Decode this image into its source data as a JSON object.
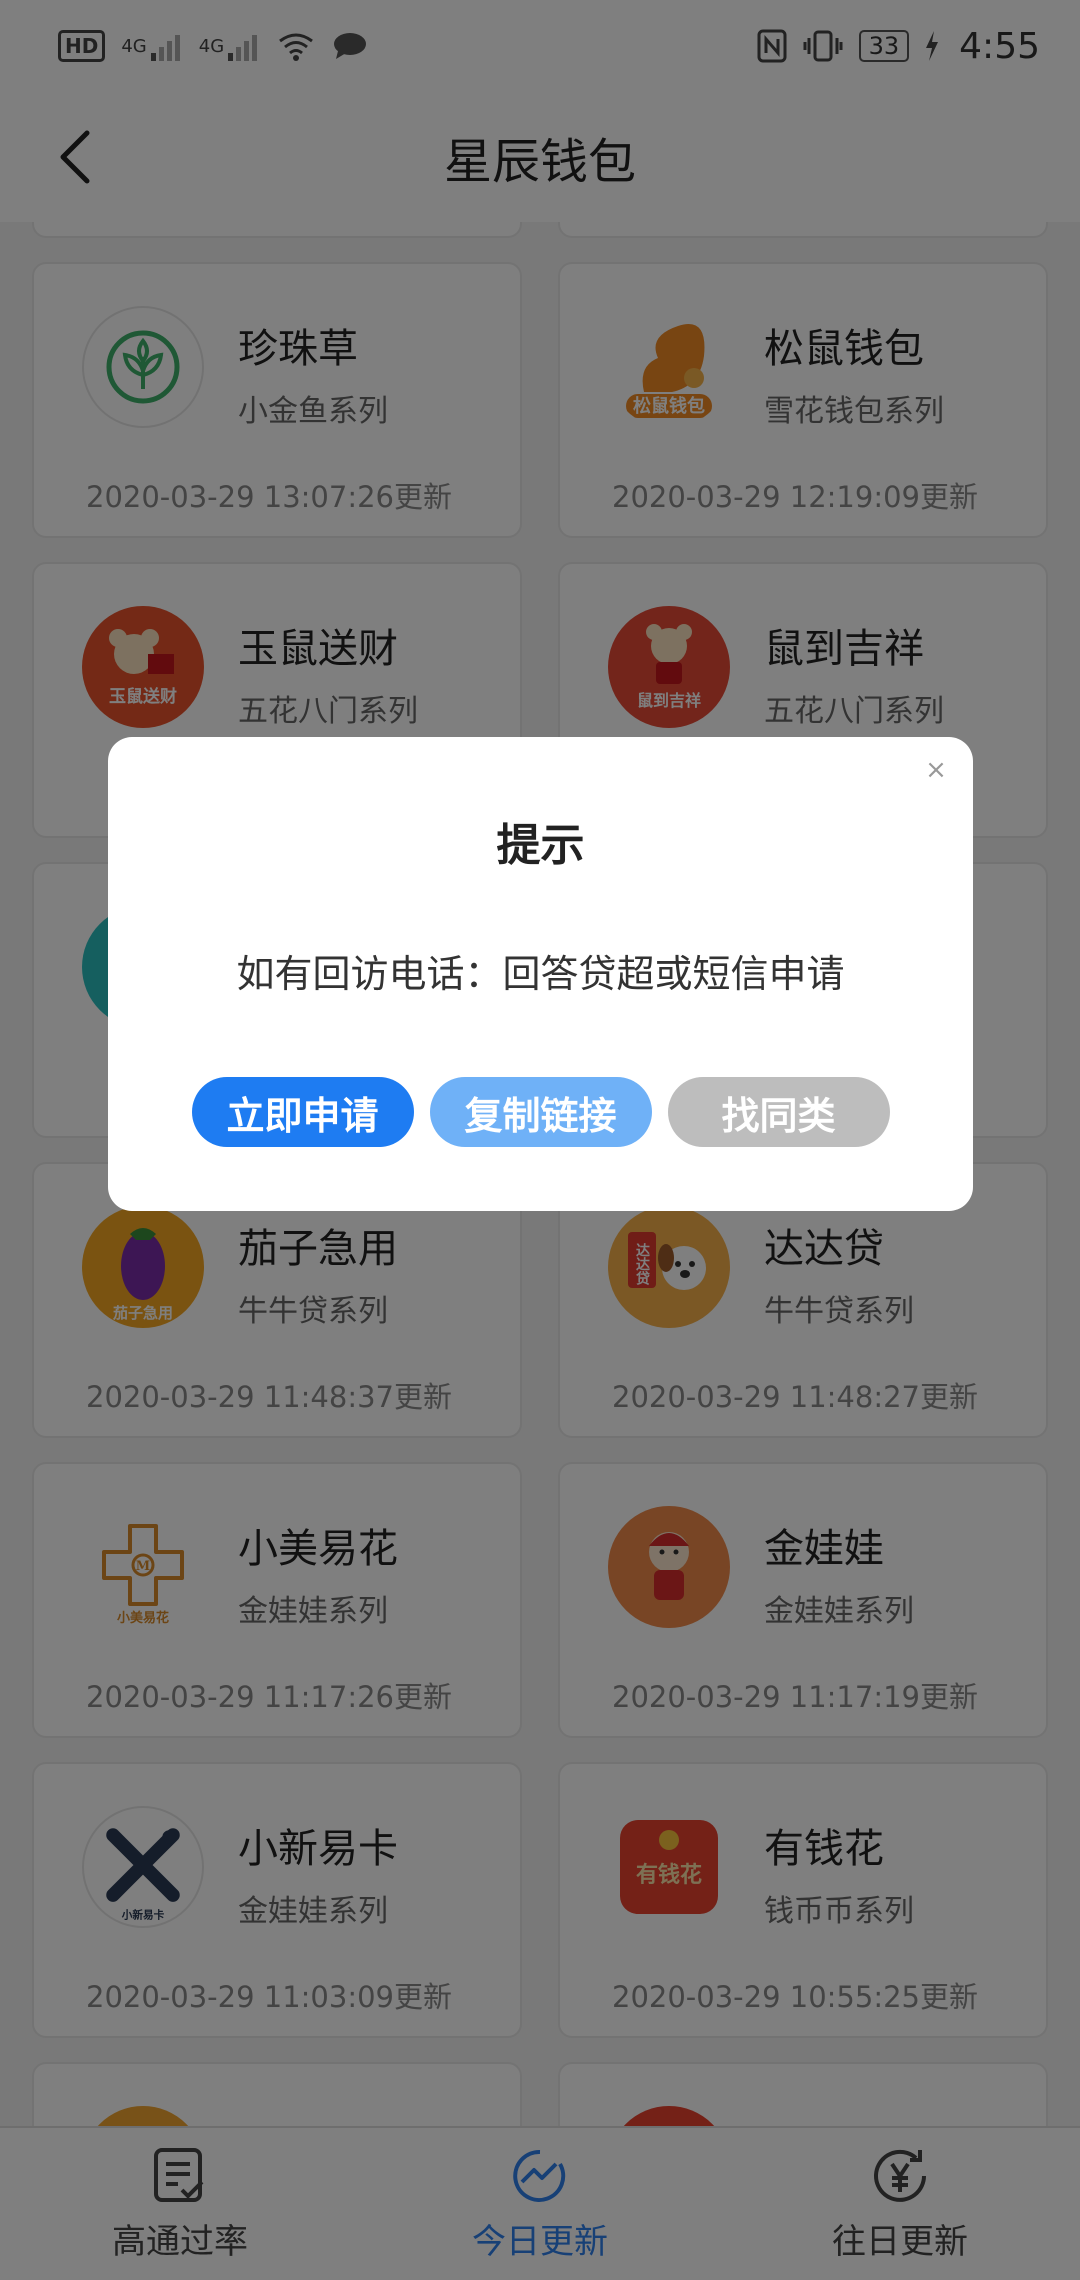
{
  "status_bar": {
    "hd": "HD",
    "sim1": "4G",
    "sim2": "4G",
    "battery": "33",
    "time": "4:55"
  },
  "header": {
    "title": "星辰钱包",
    "back_icon": "chevron-left-icon"
  },
  "cards": [
    {
      "name": "珍珠草",
      "series": "小金鱼系列",
      "time": "2020-03-29 13:07:26更新",
      "logo_color": "#ffffff",
      "logo_text": ""
    },
    {
      "name": "松鼠钱包",
      "series": "雪花钱包系列",
      "time": "2020-03-29 12:19:09更新",
      "logo_color": "#f08a24",
      "logo_text": "松鼠钱包"
    },
    {
      "name": "玉鼠送财",
      "series": "五花八门系列",
      "time": "",
      "logo_color": "#e8532c",
      "logo_text": "玉鼠送财"
    },
    {
      "name": "鼠到吉祥",
      "series": "五花八门系列",
      "time": "",
      "logo_color": "#e74a36",
      "logo_text": "鼠到吉祥"
    },
    {
      "name": "",
      "series": "",
      "time": "",
      "logo_color": "#2bbfbf",
      "logo_text": ""
    },
    {
      "name": "",
      "series": "",
      "time": "",
      "logo_color": "#ffffff",
      "logo_text": ""
    },
    {
      "name": "茄子急用",
      "series": "牛牛贷系列",
      "time": "2020-03-29 11:48:37更新",
      "logo_color": "#f5a623",
      "logo_text": "茄子急用"
    },
    {
      "name": "达达贷",
      "series": "牛牛贷系列",
      "time": "2020-03-29 11:48:27更新",
      "logo_color": "#f6b04a",
      "logo_text": "达达贷"
    },
    {
      "name": "小美易花",
      "series": "金娃娃系列",
      "time": "2020-03-29 11:17:26更新",
      "logo_color": "#ffffff",
      "logo_text": "小美易花"
    },
    {
      "name": "金娃娃",
      "series": "金娃娃系列",
      "time": "2020-03-29 11:17:19更新",
      "logo_color": "#f08a4b",
      "logo_text": ""
    },
    {
      "name": "小新易卡",
      "series": "金娃娃系列",
      "time": "2020-03-29 11:03:09更新",
      "logo_color": "#ffffff",
      "logo_text": "小新易卡"
    },
    {
      "name": "有钱花",
      "series": "钱币币系列",
      "time": "2020-03-29 10:55:25更新",
      "logo_color": "#e8432f",
      "logo_text": "有钱花"
    }
  ],
  "dialog": {
    "title": "提示",
    "message": "如有回访电话：回答贷超或短信申请",
    "close_icon": "close-icon",
    "buttons": [
      {
        "label": "立即申请",
        "color": "#1e7cf2"
      },
      {
        "label": "复制链接",
        "color": "#6fb1f7"
      },
      {
        "label": "找同类",
        "color": "#bdbdbd"
      }
    ]
  },
  "tabs": [
    {
      "label": "高通过率",
      "icon": "document-check-icon",
      "active": false
    },
    {
      "label": "今日更新",
      "icon": "trend-circle-icon",
      "active": true
    },
    {
      "label": "往日更新",
      "icon": "yen-history-icon",
      "active": false
    }
  ],
  "colors": {
    "accent": "#2f80ed",
    "overlay": "rgba(0,0,0,0.5)"
  }
}
